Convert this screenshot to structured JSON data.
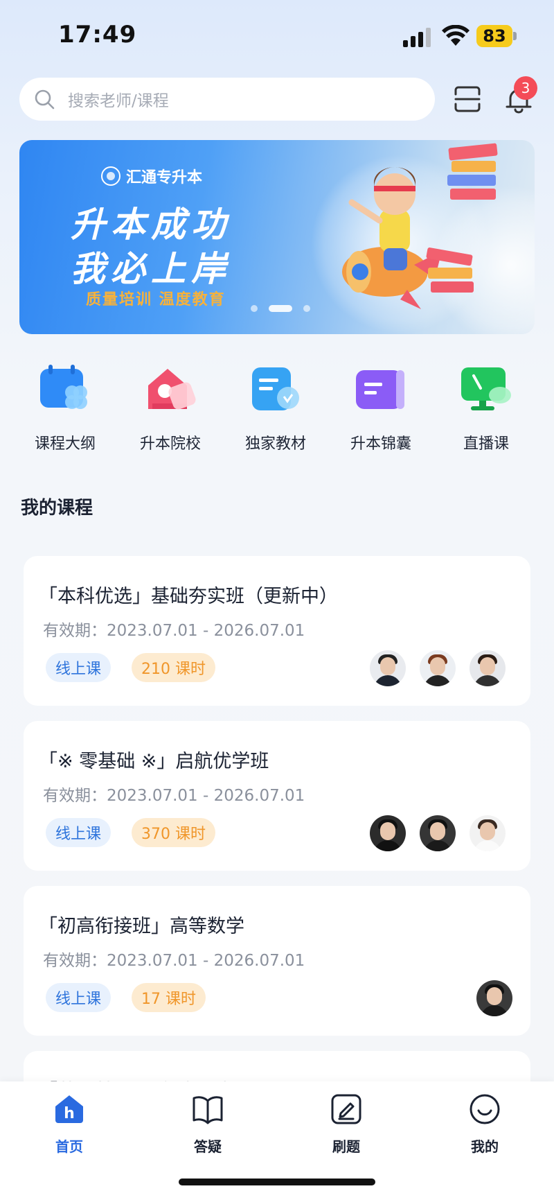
{
  "status_bar": {
    "time": "17:49",
    "battery": "83"
  },
  "search": {
    "placeholder": "搜索老师/课程"
  },
  "notifications": {
    "count": "3"
  },
  "banner": {
    "brand": "汇通专升本",
    "title_line1": "升本成功",
    "title_line2": "我必上岸",
    "slogan": "质量培训 温度教育",
    "dots": 3,
    "active_dot": 1
  },
  "quick_menu": [
    {
      "label": "课程大纲",
      "icon": "syllabus-icon",
      "color": "#2f8bf7"
    },
    {
      "label": "升本院校",
      "icon": "school-icon",
      "color": "#f0506e"
    },
    {
      "label": "独家教材",
      "icon": "textbook-icon",
      "color": "#36a3f3"
    },
    {
      "label": "升本锦囊",
      "icon": "tips-icon",
      "color": "#8b5cf6"
    },
    {
      "label": "直播课",
      "icon": "live-icon",
      "color": "#22c55e"
    }
  ],
  "section": {
    "title": "我的课程"
  },
  "courses": [
    {
      "title": "「本科优选」基础夯实班（更新中）",
      "validity": "有效期：2023.07.01 - 2026.07.01",
      "mode": "线上课",
      "hours": "210 课时",
      "teachers": 3
    },
    {
      "title": "「※ 零基础 ※」启航优学班",
      "validity": "有效期：2023.07.01 - 2026.07.01",
      "mode": "线上课",
      "hours": "370 课时",
      "teachers": 3
    },
    {
      "title": "「初高衔接班」高等数学",
      "validity": "有效期：2023.07.01 - 2026.07.01",
      "mode": "线上课",
      "hours": "17 课时",
      "teachers": 1
    },
    {
      "title": "「英语基础·日多隣习法则」",
      "validity": "",
      "mode": "",
      "hours": "",
      "teachers": 0
    }
  ],
  "tab_bar": [
    {
      "label": "首页",
      "icon": "home-icon",
      "active": true
    },
    {
      "label": "答疑",
      "icon": "book-icon",
      "active": false
    },
    {
      "label": "刷题",
      "icon": "edit-icon",
      "active": false
    },
    {
      "label": "我的",
      "icon": "profile-icon",
      "active": false
    }
  ],
  "colors": {
    "accent": "#2a6ae0",
    "badge": "#f44c57",
    "tag_online_bg": "#e8f1fd",
    "tag_hours_bg": "#fdebd0"
  }
}
